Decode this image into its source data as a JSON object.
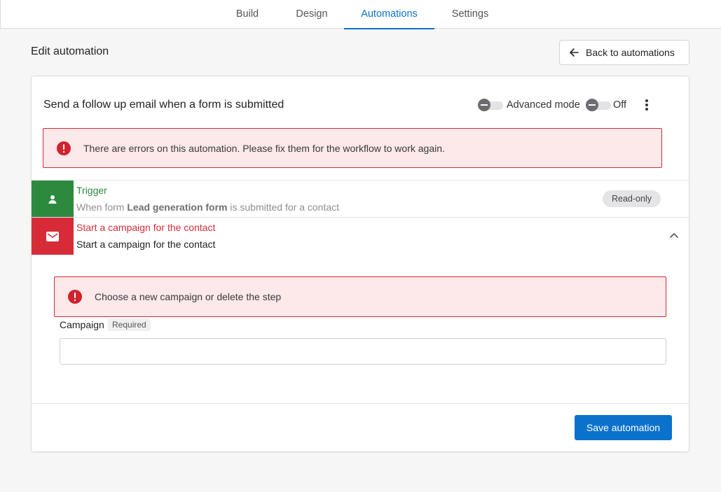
{
  "tabs": [
    {
      "label": "Build",
      "active": false
    },
    {
      "label": "Design",
      "active": false
    },
    {
      "label": "Automations",
      "active": true
    },
    {
      "label": "Settings",
      "active": false
    }
  ],
  "page": {
    "title": "Edit automation",
    "back_label": "Back to automations"
  },
  "automation": {
    "title": "Send a follow up email when a form is submitted",
    "advanced_mode_label": "Advanced mode",
    "advanced_mode_on": false,
    "status_label": "Off",
    "status_on": false,
    "error_message": "There are errors on this automation. Please fix them for the workflow to work again."
  },
  "trigger": {
    "title": "Trigger",
    "desc_prefix": "When form ",
    "form_name": "Lead generation form",
    "desc_suffix": " is submitted for a contact",
    "badge": "Read-only",
    "color": "#2c8a3e"
  },
  "action": {
    "title": "Start a campaign for the contact",
    "desc": "Start a campaign for the contact",
    "color": "#d72c38",
    "error_message": "Choose a new campaign or delete the step",
    "field_label": "Campaign",
    "field_required": "Required",
    "field_value": ""
  },
  "footer": {
    "save_label": "Save automation"
  },
  "colors": {
    "accent": "#0b72cc",
    "error": "#d1222e",
    "error_bg": "#fde8ea",
    "trigger_green": "#2c8a3e",
    "action_red": "#d72c38"
  },
  "icons": {
    "back": "arrow-left-icon",
    "menu": "more-vertical-icon",
    "error": "error-circle-icon",
    "trigger": "person-icon",
    "action": "envelope-icon",
    "collapse": "chevron-up-icon"
  }
}
